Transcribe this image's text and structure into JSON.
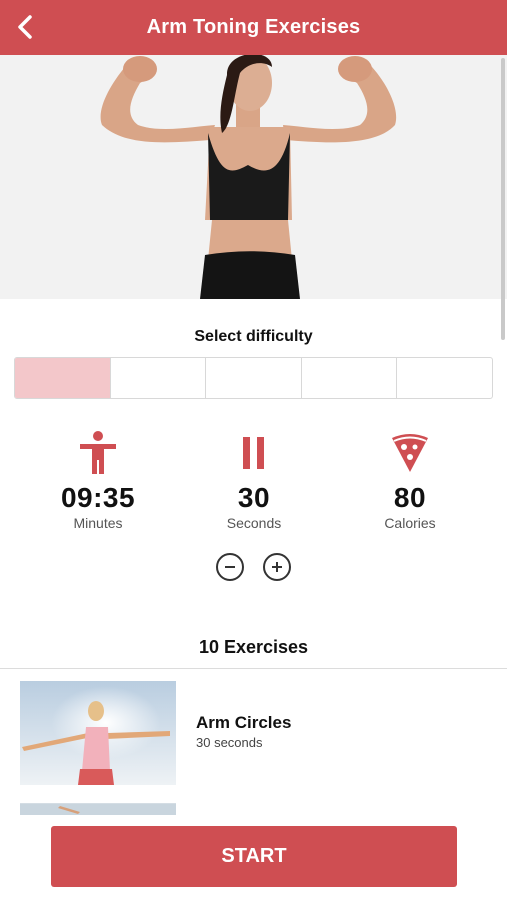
{
  "header": {
    "title": "Arm Toning Exercises",
    "back_icon": "chevron-left-icon",
    "color": "#cf4e52"
  },
  "difficulty": {
    "label": "Select difficulty",
    "levels": 5,
    "selected_index": 0
  },
  "stats": [
    {
      "icon": "person-icon",
      "value": "09:35",
      "unit": "Minutes"
    },
    {
      "icon": "pause-icon",
      "value": "30",
      "unit": "Seconds"
    },
    {
      "icon": "pizza-icon",
      "value": "80",
      "unit": "Calories"
    }
  ],
  "controls": {
    "decrement_icon": "minus-circle-icon",
    "increment_icon": "plus-circle-icon"
  },
  "exercises": {
    "count_label": "10 Exercises",
    "items": [
      {
        "name": "Arm Circles",
        "duration": "30 seconds"
      }
    ]
  },
  "start_button": {
    "label": "START"
  }
}
